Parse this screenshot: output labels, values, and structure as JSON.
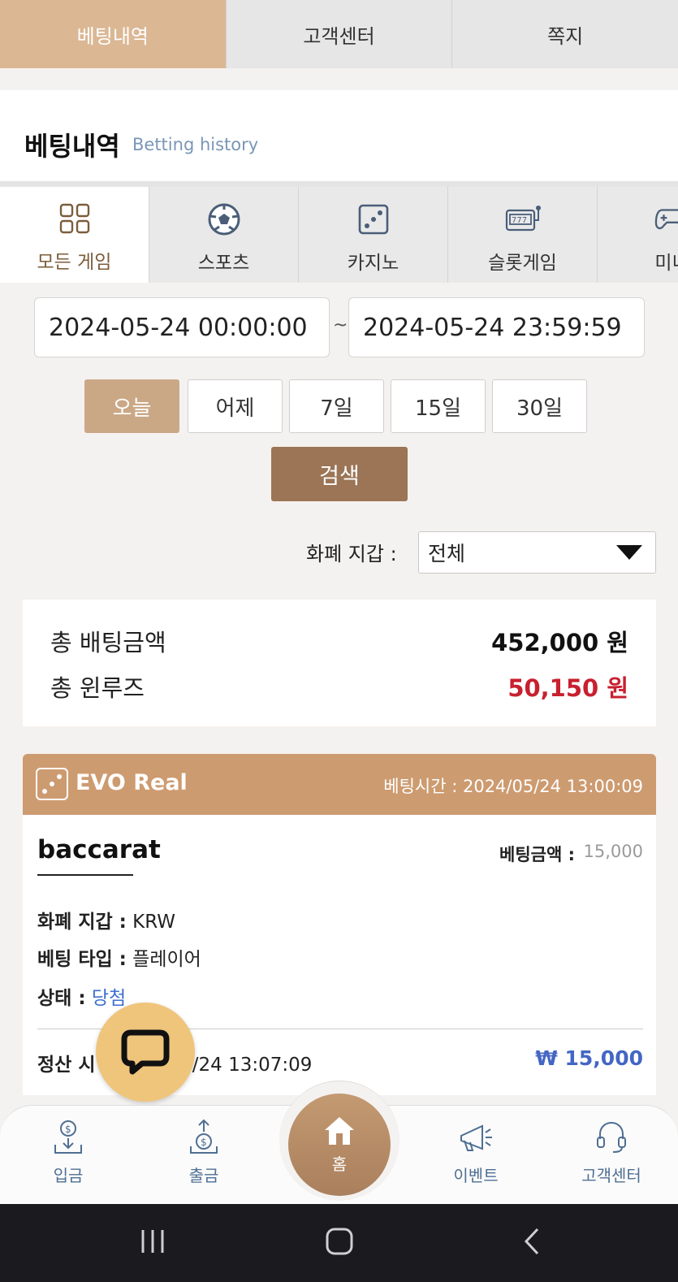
{
  "top_tabs": [
    {
      "label": "베팅내역",
      "active": true
    },
    {
      "label": "고객센터",
      "active": false
    },
    {
      "label": "쪽지",
      "active": false
    }
  ],
  "header": {
    "title": "베팅내역",
    "subtitle": "Betting history"
  },
  "categories": [
    {
      "label": "모든 게임",
      "icon": "grid-icon",
      "active": true
    },
    {
      "label": "스포츠",
      "icon": "soccer-ball-icon",
      "active": false
    },
    {
      "label": "카지노",
      "icon": "dice-icon",
      "active": false
    },
    {
      "label": "슬롯게임",
      "icon": "slot-machine-icon",
      "active": false
    },
    {
      "label": "미니",
      "icon": "gamepad-icon",
      "active": false
    }
  ],
  "date_range": {
    "from": "2024-05-24 00:00:00",
    "separator": "~",
    "to": "2024-05-24 23:59:59"
  },
  "quick_ranges": [
    {
      "label": "오늘",
      "active": true
    },
    {
      "label": "어제",
      "active": false
    },
    {
      "label": "7일",
      "active": false
    },
    {
      "label": "15일",
      "active": false
    },
    {
      "label": "30일",
      "active": false
    }
  ],
  "search_label": "검색",
  "wallet": {
    "label": "화폐 지갑 :",
    "selected": "전체"
  },
  "summary": {
    "total_bet_label": "총 배팅금액",
    "total_bet_value": "452,000 원",
    "total_winloss_label": "총 윈루즈",
    "total_winloss_value": "50,150 원",
    "winloss_color": "#c8202f"
  },
  "bet": {
    "provider": "EVO Real",
    "bet_time_label": "베팅시간 :",
    "bet_time": "2024/05/24 13:00:09",
    "game": "baccarat",
    "amount_label": "베팅금액 :",
    "amount": "15,000",
    "wallet_label": "화폐 지갑 :",
    "wallet": "KRW",
    "type_label": "베팅 타입 :",
    "type": "플레이어",
    "status_label": "상태 :",
    "status": "당첨",
    "settle_label": "정산 시",
    "settle_time": "05/24 13:07:09",
    "payout": "₩ 15,000"
  },
  "bottom_nav": {
    "deposit": "입금",
    "withdraw": "출금",
    "home": "홈",
    "event": "이벤트",
    "support": "고객센터"
  },
  "colors": {
    "accent": "#dbb794",
    "brand_dark": "#9b7555",
    "card_header": "#cd9b70",
    "link_blue": "#4466c4"
  }
}
